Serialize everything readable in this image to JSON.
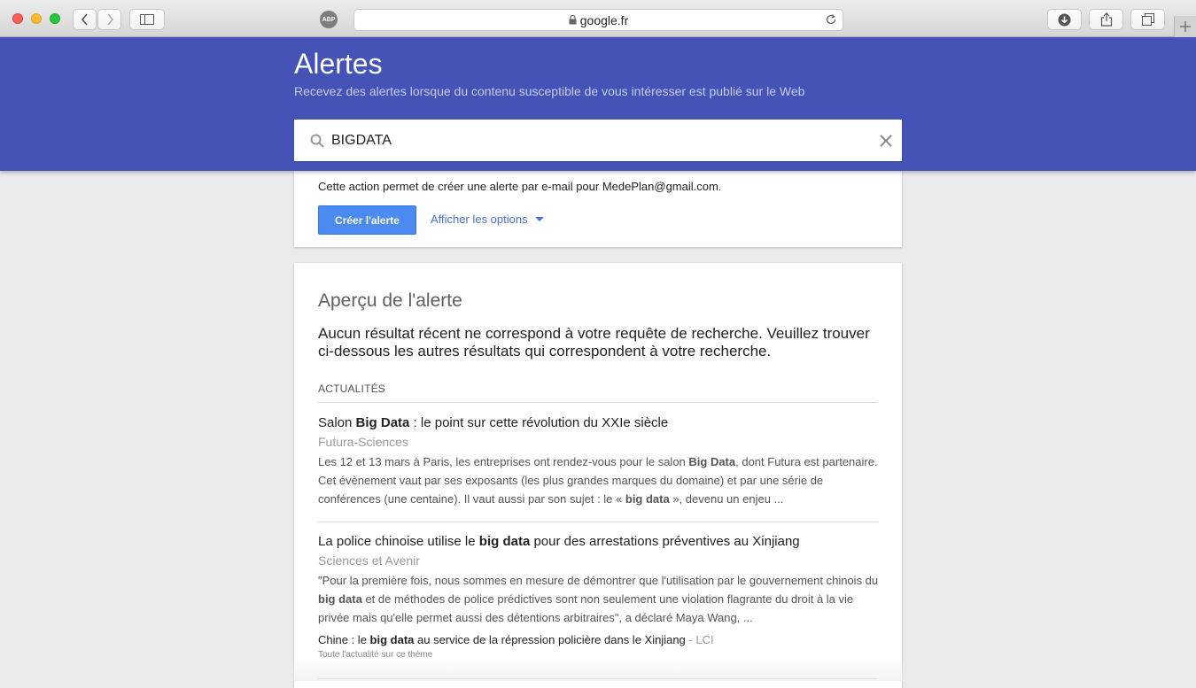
{
  "browser": {
    "url": "google.fr",
    "abp_label": "ABP"
  },
  "header": {
    "title": "Alertes",
    "subtitle": "Recevez des alertes lorsque du contenu susceptible de vous intéresser est publié sur le Web",
    "search_value": "BIGDATA"
  },
  "create_card": {
    "info": "Cette action permet de créer une alerte par e-mail pour MedePlan@gmail.com.",
    "create_button": "Créer l'alerte",
    "options_link": "Afficher les options"
  },
  "preview": {
    "title": "Aperçu de l'alerte",
    "no_result": "Aucun résultat récent ne correspond à votre requête de recherche. Veuillez trouver ci-dessous les autres résultats qui correspondent à votre recherche.",
    "section": "ACTUALITÉS",
    "items": [
      {
        "head_pre": "Salon ",
        "head_bold": "Big Data",
        "head_post": " : le point sur cette révolution du XXIe siècle",
        "source": "Futura-Sciences",
        "snip_1": "Les 12 et 13 mars à Paris, les entreprises ont rendez-vous pour le salon ",
        "snip_b1": "Big Data",
        "snip_2": ", dont Futura est partenaire. Cet évènement vaut par ses exposants (les plus grandes marques du domaine) et par une série de conférences (une centaine). Il vaut aussi par son sujet : le « ",
        "snip_b2": "big data",
        "snip_3": " », devenu un enjeu ..."
      },
      {
        "head_pre": "La police chinoise utilise le ",
        "head_bold": "big data",
        "head_post": " pour des arrestations préventives au Xinjiang",
        "source": "Sciences et Avenir",
        "snip_1": "\"Pour la première fois, nous sommes en mesure de démontrer que l'utilisation par le gouvernement chinois du ",
        "snip_b1": "big data",
        "snip_2": " et de méthodes de police prédictives sont non seulement une violation flagrante du droit à la vie privée mais qu'elle permet aussi des détentions arbitraires\", a déclaré Maya Wang, ...",
        "related_pre": "Chine : le ",
        "related_bold": "big data",
        "related_post": " au service de la répression policière dans le Xinjiang",
        "related_source": " - LCI",
        "more": "Toute l'actualité sur ce thème"
      }
    ]
  }
}
